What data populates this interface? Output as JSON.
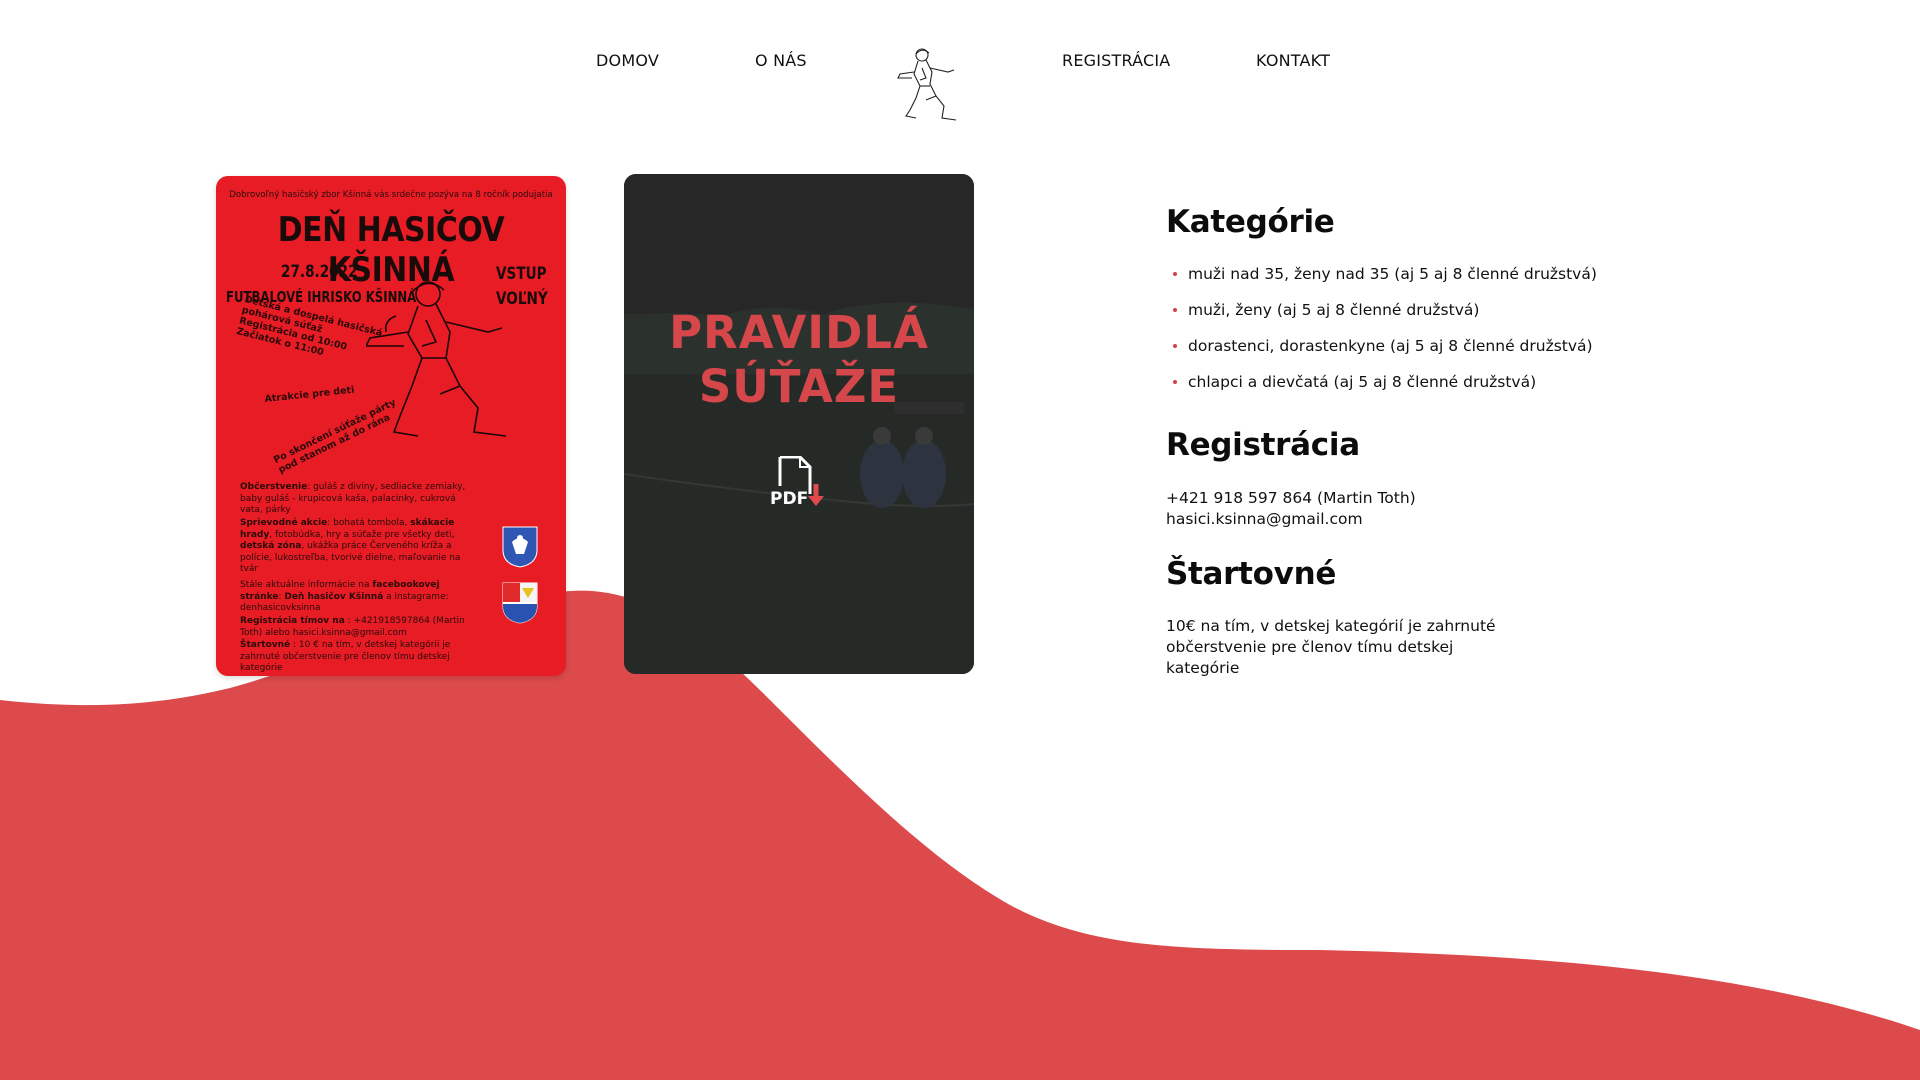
{
  "nav": {
    "home": "DOMOV",
    "about": "O NÁS",
    "registration": "REGISTRÁCIA",
    "contact": "KONTAKT",
    "logo_icon": "firefighter-logo-icon"
  },
  "poster": {
    "top_line": "Dobrovoľný hasičský zbor Kšinná vás srdečne pozýva na 8 ročník podujatia",
    "title": "DEŇ HASIČOV KŠINNÁ",
    "date": "27.8.2022",
    "place": "FUTBALOVÉ IHRISKO KŠINNÁ",
    "entry_1": "VSTUP",
    "entry_2": "VOĽNÝ",
    "rot_1": "Detská a dospelá hasičská",
    "rot_2": "pohárová súťaž",
    "rot_3": "Registrácia od 10:00",
    "rot_4": "Začiatok o 11:00",
    "rot_5": "Atrakcie pre deti",
    "rot_6": "Po skončení súťaže párty",
    "rot_7": "pod stanom až do rána",
    "refresh_label": "Občerstvenie",
    "refresh_text": ": guláš z diviny, sedliacke zemiaky, baby guláš - krupicová kaša, palacinky, cukrová vata, párky",
    "side_label": "Sprievodné akcie",
    "side_text_1": ": bohatá tombola, ",
    "side_bold": "skákacie hrady",
    "side_text_2": ", fotobúdka, hry a súťaže pre všetky deti, ",
    "side_bold_2": "detská zóna",
    "side_text_3": ", ukážka práce Červeného kríža a polície, lukostreľba, tvorivé dielne, maľovanie na tvár",
    "info_text_1": "Stále aktuálne informácie na ",
    "info_bold_1": "facebookovej stránke",
    "info_text_2": ": ",
    "info_bold_2": "Deň hasičov Kšinná",
    "info_text_3": " a instagrame: denhasicovksinna",
    "reg_label": "Registrácia tímov na",
    "reg_text": " : +421918597864 (Martin Toth) alebo hasici.ksinna@gmail.com",
    "fee_label": "Štartovné",
    "fee_text": " : 10 € na tím, v detskej kategórii je zahrnuté občerstvenie pre členov tímu detskej kategórie",
    "colors": {
      "background": "#e81c25",
      "text": "#1a0b0b"
    }
  },
  "pdf_card": {
    "title_line1": "PRAVIDLÁ",
    "title_line2": "SÚŤAŽE",
    "icon_label": "PDF",
    "icon": "pdf-download-icon",
    "colors": {
      "title": "#d6474b",
      "overlay": "#232323"
    }
  },
  "info": {
    "categories_heading": "Kategórie",
    "categories": [
      "muži nad 35, ženy nad 35 (aj 5 aj 8 členné družstvá)",
      "muži, ženy (aj 5 aj 8 členné družstvá)",
      "dorastenci, dorastenkyne (aj 5 aj 8 členné družstvá)",
      "chlapci a dievčatá (aj 5 aj 8 členné družstvá)"
    ],
    "registration_heading": "Registrácia",
    "registration_phone": "+421 918 597 864 (Martin Toth)",
    "registration_email": "hasici.ksinna@gmail.com",
    "fee_heading": "Štartovné",
    "fee_text": "10€ na tím, v detskej kategórií je zahrnuté občerstvenie pre členov tímu detskej kategórie"
  },
  "colors": {
    "accent": "#dc4a4c",
    "bullet": "#d74247"
  }
}
